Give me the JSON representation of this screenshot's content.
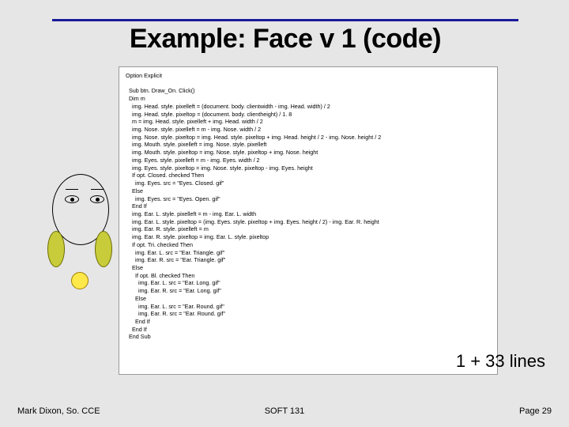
{
  "title": "Example: Face v 1 (code)",
  "code": "Option Explicit\n\n  Sub btn. Draw_On. Click()\n  Dim m\n    img. Head. style. pixelleft = (document. body. clientwidth - img. Head. width) / 2\n    img. Head. style. pixeltop = (document. body. clientheight) / 1. 8\n    m = img. Head. style. pixelleft + img. Head. width / 2\n    img. Nose. style. pixelleft = m - img. Nose. width / 2\n    img. Nose. style. pixeltop = img. Head. style. pixeltop + img. Head. height / 2 - img. Nose. height / 2\n    img. Mouth. style. pixelleft = img. Nose. style. pixelleft\n    img. Mouth. style. pixeltop = img. Nose. style. pixeltop + img. Nose. height\n    img. Eyes. style. pixelleft = m - img. Eyes. width / 2\n    img. Eyes. style. pixeltop = img. Nose. style. pixeltop - img. Eyes. height\n    If opt. Closed. checked Then\n      img. Eyes. src = \"Eyes. Closed. gif\"\n    Else\n      img. Eyes. src = \"Eyes. Open. gif\"\n    End If\n    img. Ear. L. style. pixelleft = m - img. Ear. L. width\n    img. Ear. L. style. pixeltop = (img. Eyes. style. pixeltop + img. Eyes. height / 2) - img. Ear. R. height\n    img. Ear. R. style. pixelleft = m\n    img. Ear. R. style. pixeltop = img. Ear. L. style. pixeltop\n    If opt. Tri. checked Then\n      img. Ear. L. src = \"Ear. Triangle. gif\"\n      img. Ear. R. src = \"Ear. Triangle. gif\"\n    Else\n      If opt. Bl. checked Then\n        img. Ear. L. src = \"Ear. Long. gif\"\n        img. Ear. R. src = \"Ear. Long. gif\"\n      Else\n        img. Ear. L. src = \"Ear. Round. gif\"\n        img. Ear. R. src = \"Ear. Round. gif\"\n      End If\n    End If\n  End Sub",
  "lines_note": "1 + 33 lines",
  "footer": {
    "left": "Mark Dixon, So. CCE",
    "center": "SOFT 131",
    "right": "Page 29"
  }
}
